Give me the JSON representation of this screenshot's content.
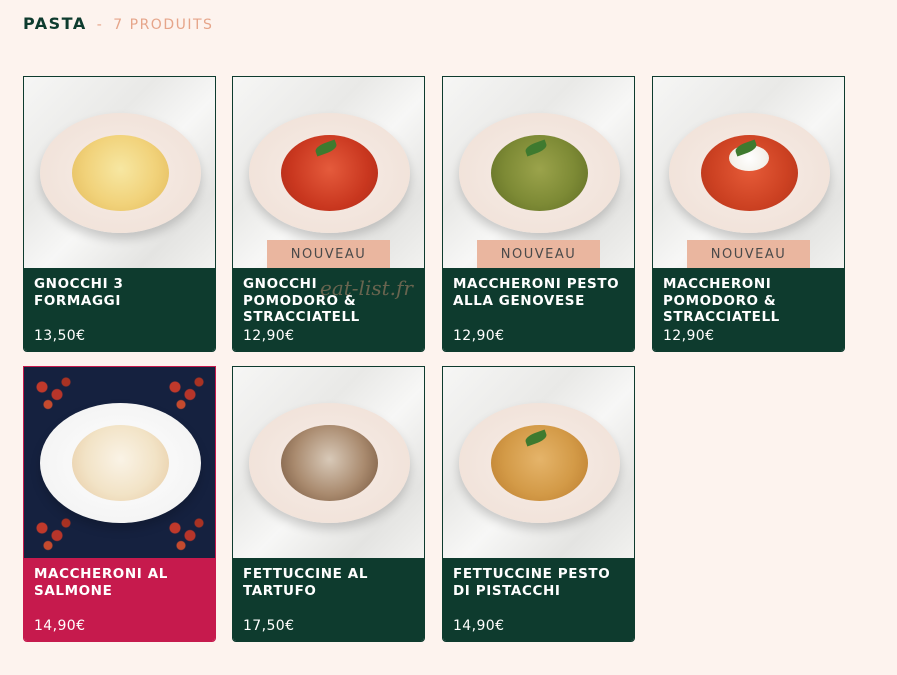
{
  "header": {
    "title": "PASTA",
    "separator": "-",
    "count": "7 PRODUITS"
  },
  "badge_label": "NOUVEAU",
  "products": [
    {
      "name": "GNOCCHI 3 FORMAGGI",
      "price": "13,50€",
      "is_new": false
    },
    {
      "name": "GNOCCHI POMODORO & STRACCIATELL",
      "price": "12,90€",
      "is_new": true
    },
    {
      "name": "MACCHERONI PESTO ALLA GENOVESE",
      "price": "12,90€",
      "is_new": true
    },
    {
      "name": "MACCHERONI POMODORO & STRACCIATELL",
      "price": "12,90€",
      "is_new": true
    },
    {
      "name": "MACCHERONI AL SALMONE",
      "price": "14,90€",
      "is_new": false
    },
    {
      "name": "FETTUCCINE AL TARTUFO",
      "price": "17,50€",
      "is_new": false
    },
    {
      "name": "FETTUCCINE PESTO DI PISTACCHI",
      "price": "14,90€",
      "is_new": false
    }
  ],
  "watermark": "eat-list.fr",
  "colors": {
    "background": "#fdf3ee",
    "card_green": "#0e3b2e",
    "card_special": "#c61a4d",
    "badge": "#eab69f",
    "header_accent": "#e6a58a"
  }
}
